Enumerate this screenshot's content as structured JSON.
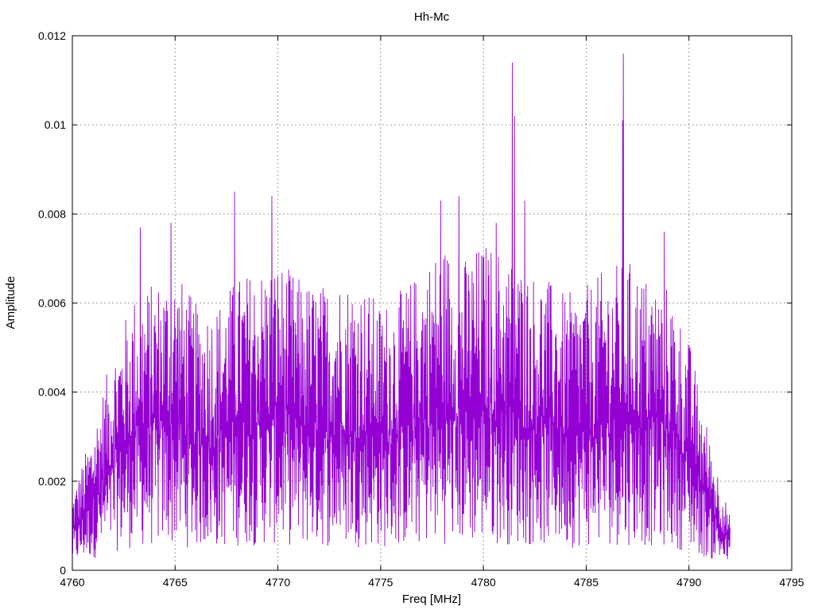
{
  "chart_data": {
    "type": "line",
    "title": "Hh-Mc",
    "xlabel": "Freq [MHz]",
    "ylabel": "Amplitude",
    "xlim": [
      4760,
      4795
    ],
    "ylim": [
      0,
      0.012
    ],
    "x_ticks": [
      "4760",
      "4765",
      "4770",
      "4775",
      "4780",
      "4785",
      "4790",
      "4795"
    ],
    "y_ticks": [
      "0",
      "0.002",
      "0.004",
      "0.006",
      "0.008",
      "0.01",
      "0.012"
    ],
    "grid": true,
    "legend": "none",
    "x_range_of_data": [
      4760,
      4792
    ],
    "series": [
      {
        "color": "#9400d3",
        "style": "dense oscillating spectrum",
        "envelope_x": [
          4760,
          4761,
          4762,
          4763,
          4764,
          4765,
          4766,
          4767,
          4768,
          4769,
          4770,
          4771,
          4772,
          4773,
          4774,
          4775,
          4776,
          4777,
          4778,
          4779,
          4780,
          4781,
          4782,
          4783,
          4784,
          4785,
          4786,
          4787,
          4788,
          4789,
          4790,
          4791,
          4792
        ],
        "envelope_y": [
          0.0017,
          0.0032,
          0.005,
          0.0062,
          0.0065,
          0.0068,
          0.006,
          0.006,
          0.0066,
          0.0068,
          0.007,
          0.0066,
          0.0064,
          0.0066,
          0.0065,
          0.006,
          0.0063,
          0.0068,
          0.0074,
          0.007,
          0.0074,
          0.0072,
          0.0068,
          0.0066,
          0.0062,
          0.0064,
          0.0068,
          0.007,
          0.0066,
          0.0064,
          0.0052,
          0.003,
          0.0012
        ],
        "peaks": [
          {
            "x": 4763.3,
            "y": 0.0077
          },
          {
            "x": 4764.8,
            "y": 0.0078
          },
          {
            "x": 4767.9,
            "y": 0.0085
          },
          {
            "x": 4769.7,
            "y": 0.0084
          },
          {
            "x": 4777.9,
            "y": 0.0083
          },
          {
            "x": 4778.8,
            "y": 0.0084
          },
          {
            "x": 4780.6,
            "y": 0.0078
          },
          {
            "x": 4781.4,
            "y": 0.0114
          },
          {
            "x": 4781.5,
            "y": 0.0102
          },
          {
            "x": 4782.0,
            "y": 0.0083
          },
          {
            "x": 4786.8,
            "y": 0.0116
          },
          {
            "x": 4786.75,
            "y": 0.0101
          },
          {
            "x": 4788.8,
            "y": 0.0076
          }
        ]
      }
    ]
  }
}
